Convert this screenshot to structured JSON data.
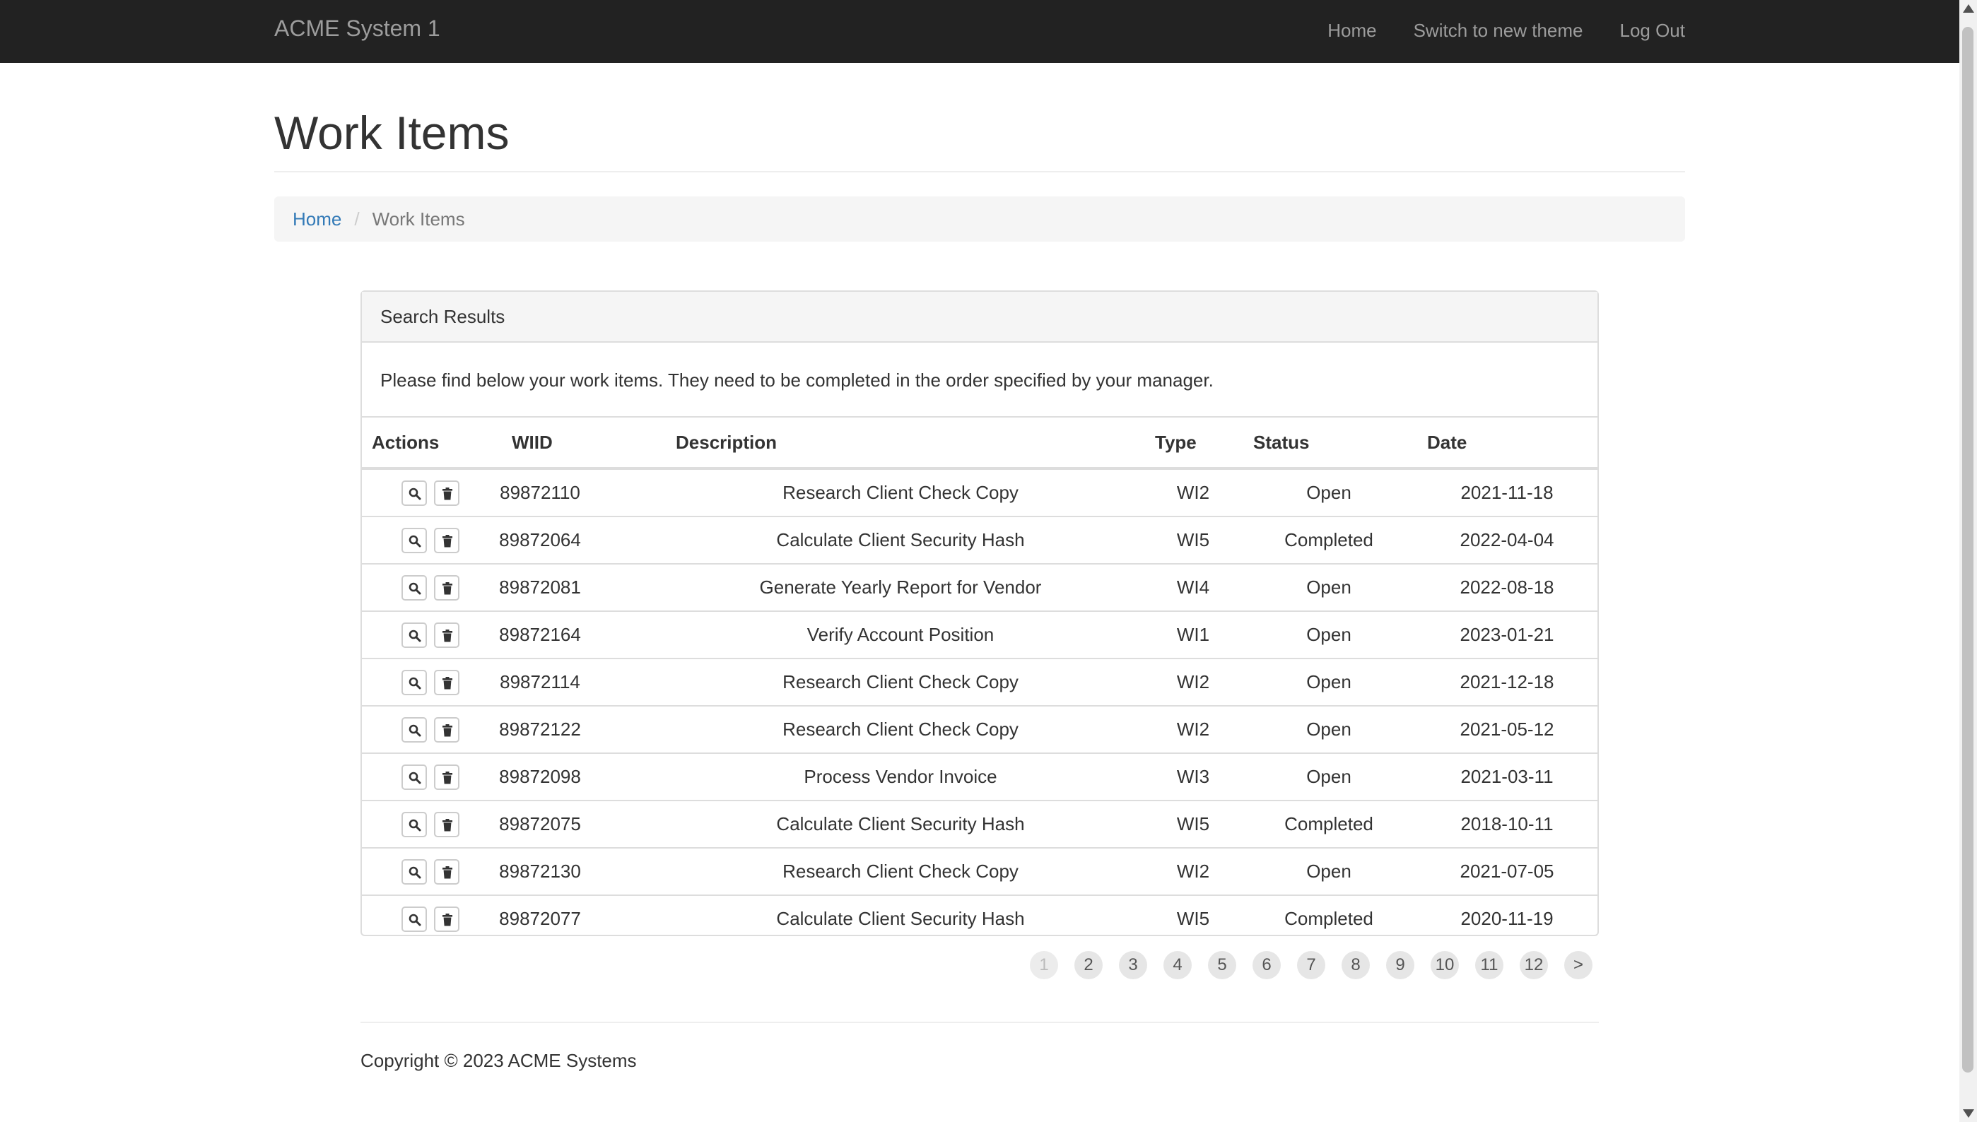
{
  "navbar": {
    "brand": "ACME System 1",
    "links": [
      "Home",
      "Switch to new theme",
      "Log Out"
    ]
  },
  "page_title": "Work Items",
  "breadcrumb": {
    "home": "Home",
    "separator": "/",
    "current": "Work Items"
  },
  "panel": {
    "heading": "Search Results",
    "body": "Please find below your work items. They need to be completed in the order specified by your manager."
  },
  "table": {
    "headers": [
      "Actions",
      "WIID",
      "Description",
      "Type",
      "Status",
      "Date"
    ],
    "rows": [
      [
        "89872110",
        "Research Client Check Copy",
        "WI2",
        "Open",
        "2021-11-18"
      ],
      [
        "89872064",
        "Calculate Client Security Hash",
        "WI5",
        "Completed",
        "2022-04-04"
      ],
      [
        "89872081",
        "Generate Yearly Report for Vendor",
        "WI4",
        "Open",
        "2022-08-18"
      ],
      [
        "89872164",
        "Verify Account Position",
        "WI1",
        "Open",
        "2023-01-21"
      ],
      [
        "89872114",
        "Research Client Check Copy",
        "WI2",
        "Open",
        "2021-12-18"
      ],
      [
        "89872122",
        "Research Client Check Copy",
        "WI2",
        "Open",
        "2021-05-12"
      ],
      [
        "89872098",
        "Process Vendor Invoice",
        "WI3",
        "Open",
        "2021-03-11"
      ],
      [
        "89872075",
        "Calculate Client Security Hash",
        "WI5",
        "Completed",
        "2018-10-11"
      ],
      [
        "89872130",
        "Research Client Check Copy",
        "WI2",
        "Open",
        "2021-07-05"
      ],
      [
        "89872077",
        "Calculate Client Security Hash",
        "WI5",
        "Completed",
        "2020-11-19"
      ]
    ],
    "row_actions": [
      "search-icon",
      "trash-icon"
    ]
  },
  "pagination": {
    "pages": [
      "1",
      "2",
      "3",
      "4",
      "5",
      "6",
      "7",
      "8",
      "9",
      "10",
      "11",
      "12",
      ">"
    ],
    "active": "1"
  },
  "footer": "Copyright © 2023 ACME Systems",
  "colors": {
    "navbar": "#222222",
    "link": "#337ab7",
    "border": "#dddddd"
  }
}
